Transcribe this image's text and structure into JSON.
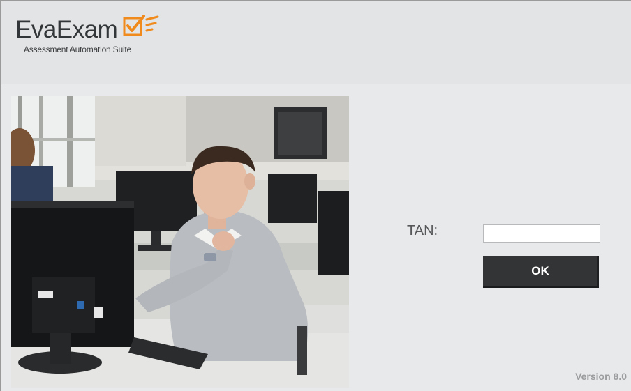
{
  "app": {
    "logo_name": "EvaExam",
    "logo_tagline": "Assessment Automation Suite"
  },
  "login": {
    "tan_label": "TAN:",
    "tan_value": "",
    "ok_label": "OK"
  },
  "footer": {
    "version": "Version 8.0"
  },
  "icons": {
    "logo_mark": "checkbox-check-icon"
  },
  "colors": {
    "accent_orange": "#f08a1c",
    "button_dark": "#333436",
    "background": "#e6e7e8"
  }
}
